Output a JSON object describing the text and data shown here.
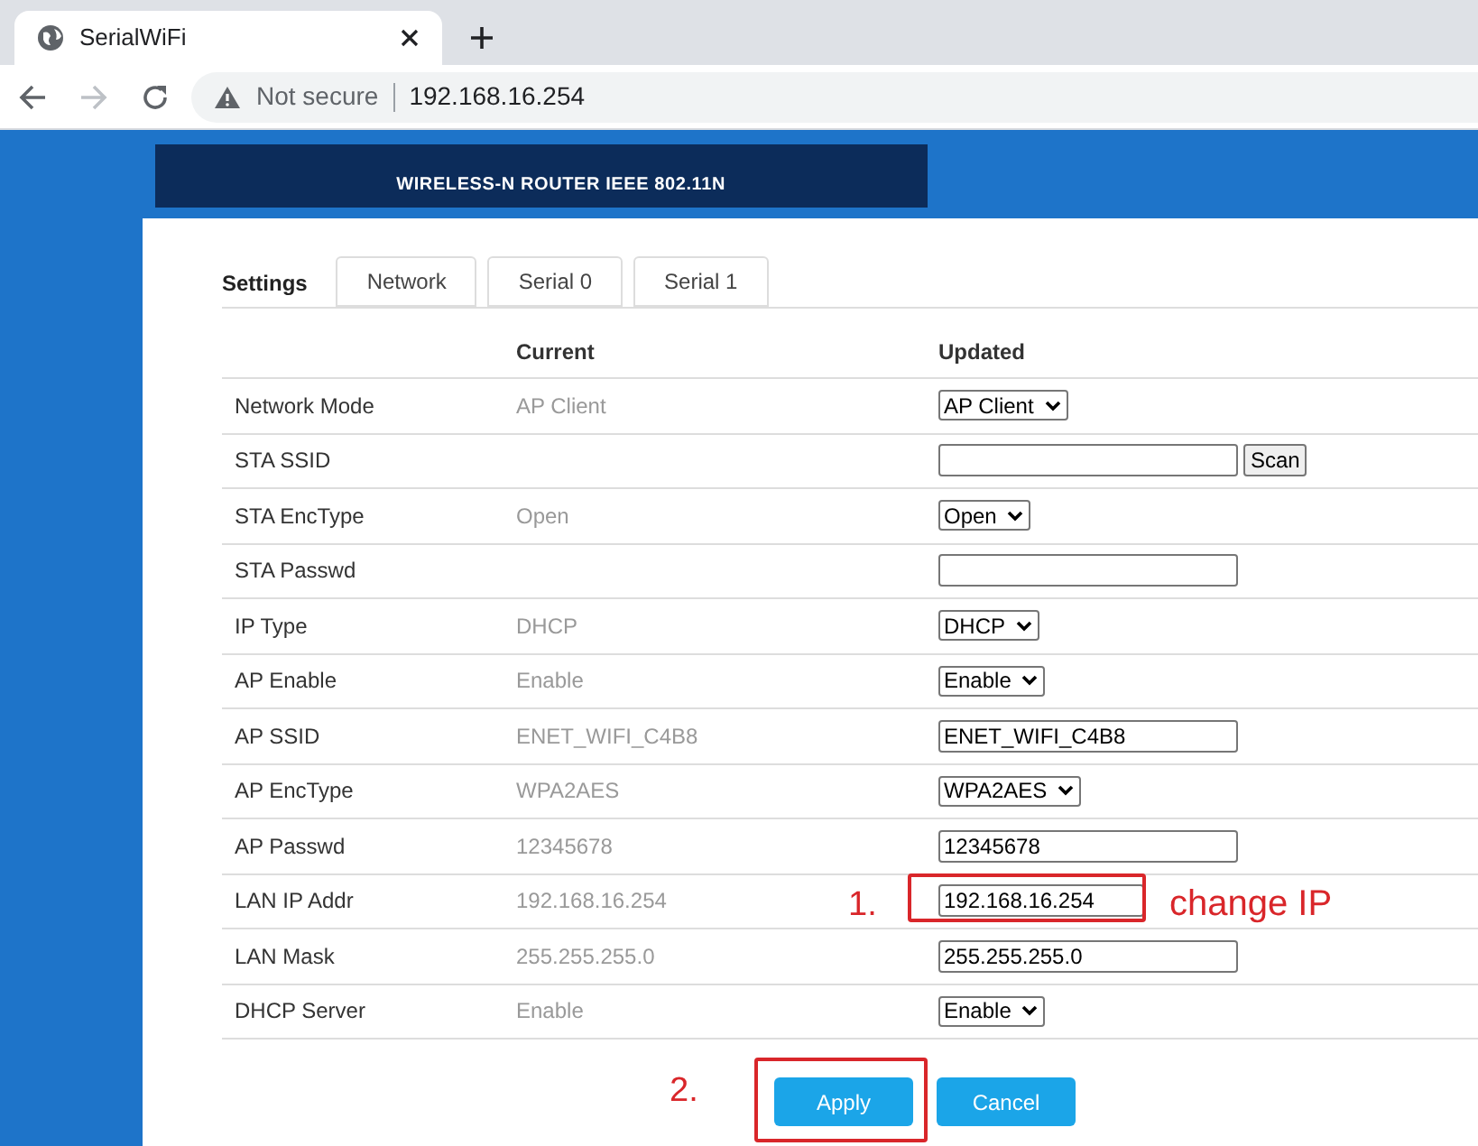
{
  "browser": {
    "tab_title": "SerialWiFi",
    "security_label": "Not secure",
    "url": "192.168.16.254"
  },
  "banner": {
    "text": "WIRELESS-N ROUTER IEEE 802.11N"
  },
  "heading": "Settings",
  "tabs": [
    {
      "label": "Network",
      "selected": false
    },
    {
      "label": "Serial 0",
      "selected": false
    },
    {
      "label": "Serial 1",
      "selected": false
    }
  ],
  "table": {
    "columns": {
      "current": "Current",
      "updated": "Updated"
    },
    "rows": [
      {
        "label": "Network Mode",
        "current": "AP Client",
        "control": {
          "kind": "select",
          "value": "AP Client"
        }
      },
      {
        "label": "STA SSID",
        "control": {
          "kind": "input",
          "button": "Scan"
        }
      },
      {
        "label": "STA EncType",
        "current": "Open",
        "control": {
          "kind": "select",
          "value": "Open"
        }
      },
      {
        "label": "STA Passwd",
        "control": {
          "kind": "input"
        }
      },
      {
        "label": "IP Type",
        "current": "DHCP",
        "control": {
          "kind": "select",
          "value": "DHCP"
        }
      },
      {
        "label": "AP Enable",
        "current": "Enable",
        "control": {
          "kind": "select",
          "value": "Enable"
        }
      },
      {
        "label": "AP SSID",
        "current": "ENET_WIFI_C4B8",
        "control": {
          "kind": "input",
          "value": "ENET_WIFI_C4B8"
        }
      },
      {
        "label": "AP EncType",
        "current": "WPA2AES",
        "control": {
          "kind": "select",
          "value": "WPA2AES"
        }
      },
      {
        "label": "AP Passwd",
        "current": "12345678",
        "control": {
          "kind": "input",
          "value": "12345678"
        }
      },
      {
        "label": "LAN IP Addr",
        "current": "192.168.16.254",
        "control": {
          "kind": "input",
          "value": "192.168.16.254",
          "highlighted": true,
          "step": "1.",
          "note": "change IP"
        }
      },
      {
        "label": "LAN Mask",
        "current": "255.255.255.0",
        "control": {
          "kind": "input",
          "value": "255.255.255.0"
        }
      },
      {
        "label": "DHCP Server",
        "current": "Enable",
        "control": {
          "kind": "select",
          "value": "Enable"
        }
      }
    ]
  },
  "buttons": [
    {
      "label": "Apply",
      "highlighted": true,
      "step": "2."
    },
    {
      "label": "Cancel",
      "highlighted": false
    }
  ]
}
